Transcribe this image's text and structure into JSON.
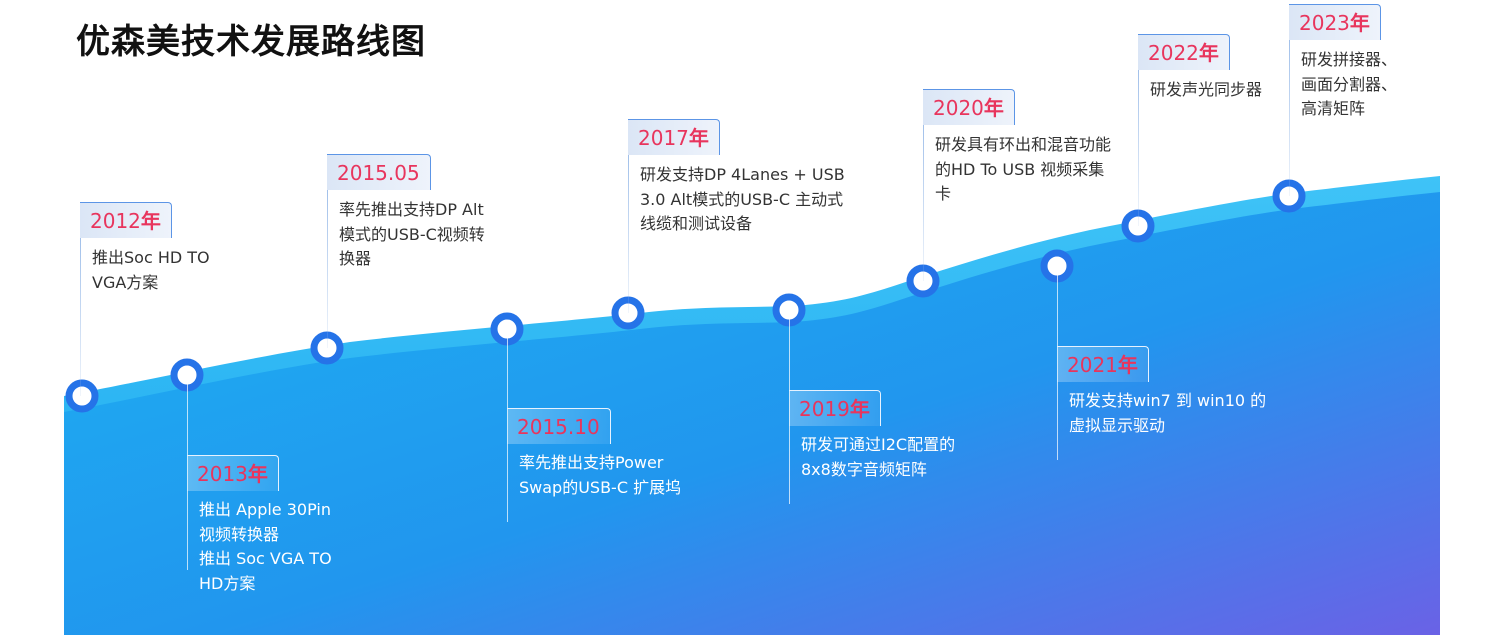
{
  "page_title": "优森美技术发展路线图",
  "milestones": [
    {
      "year": "2012",
      "suffix": "年",
      "lines": [
        "推出Soc HD TO",
        "VGA方案"
      ]
    },
    {
      "year": "2013",
      "suffix": "年",
      "lines": [
        "推出 Apple 30Pin",
        "视频转换器",
        "推出 Soc VGA TO",
        "HD方案"
      ]
    },
    {
      "year": "2015.05",
      "suffix": "",
      "lines": [
        "率先推出支持DP Alt",
        "模式的USB-C视频转",
        "换器"
      ]
    },
    {
      "year": "2015.10",
      "suffix": "",
      "lines": [
        "率先推出支持Power",
        "Swap的USB-C 扩展坞"
      ]
    },
    {
      "year": "2017",
      "suffix": "年",
      "lines": [
        "研发支持DP 4Lanes + USB",
        "3.0 Alt模式的USB-C 主动式",
        "线缆和测试设备"
      ]
    },
    {
      "year": "2019",
      "suffix": "年",
      "lines": [
        "研发可通过I2C配置的",
        "8x8数字音频矩阵"
      ]
    },
    {
      "year": "2020",
      "suffix": "年",
      "lines": [
        "研发具有环出和混音功能",
        "的HD To USB 视频采集",
        "卡"
      ]
    },
    {
      "year": "2021",
      "suffix": "年",
      "lines": [
        "研发支持win7 到 win10 的",
        "虚拟显示驱动"
      ]
    },
    {
      "year": "2022",
      "suffix": "年",
      "lines": [
        "研发声光同步器"
      ]
    },
    {
      "year": "2023",
      "suffix": "年",
      "lines": [
        "研发拼接器、",
        "画面分割器、",
        "高清矩阵"
      ]
    }
  ],
  "colors": {
    "accent_year": "#e8355d",
    "node_ring": "#2573e8",
    "wave_top": "#20aef0",
    "wave_bottom": "#6a63e4"
  }
}
